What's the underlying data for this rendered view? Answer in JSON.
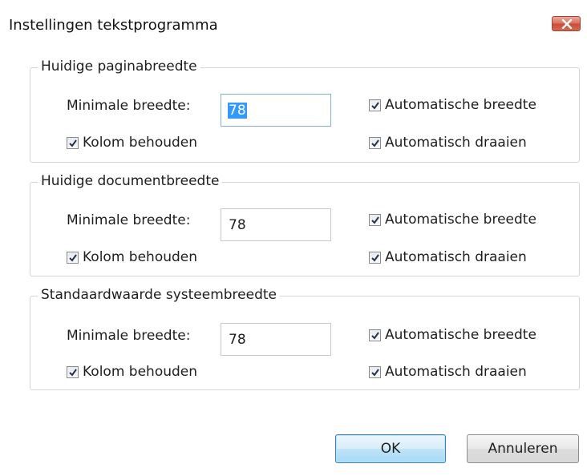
{
  "window": {
    "title": "Instellingen tekstprogramma"
  },
  "groups": [
    {
      "legend": "Huidige paginabreedte",
      "min_width_label": "Minimale breedte:",
      "min_width_value": "78",
      "keep_column_label": "Kolom behouden",
      "auto_width_label": "Automatische breedte",
      "auto_rotate_label": "Automatisch draaien",
      "keep_column_checked": true,
      "auto_width_checked": true,
      "auto_rotate_checked": true
    },
    {
      "legend": "Huidige documentbreedte",
      "min_width_label": "Minimale breedte:",
      "min_width_value": "78",
      "keep_column_label": "Kolom behouden",
      "auto_width_label": "Automatische breedte",
      "auto_rotate_label": "Automatisch draaien",
      "keep_column_checked": true,
      "auto_width_checked": true,
      "auto_rotate_checked": true
    },
    {
      "legend": "Standaardwaarde systeembreedte",
      "min_width_label": "Minimale breedte:",
      "min_width_value": "78",
      "keep_column_label": "Kolom behouden",
      "auto_width_label": "Automatische breedte",
      "auto_rotate_label": "Automatisch draaien",
      "keep_column_checked": true,
      "auto_width_checked": true,
      "auto_rotate_checked": true
    }
  ],
  "buttons": {
    "ok_label": "OK",
    "cancel_label": "Annuleren"
  },
  "icons": {
    "close": "close-icon",
    "check": "checkmark-icon"
  },
  "colors": {
    "close_button": "#d9705c",
    "selection": "#3399ff",
    "focus_border": "#7fb0e2",
    "default_button": "#bee4f7"
  }
}
